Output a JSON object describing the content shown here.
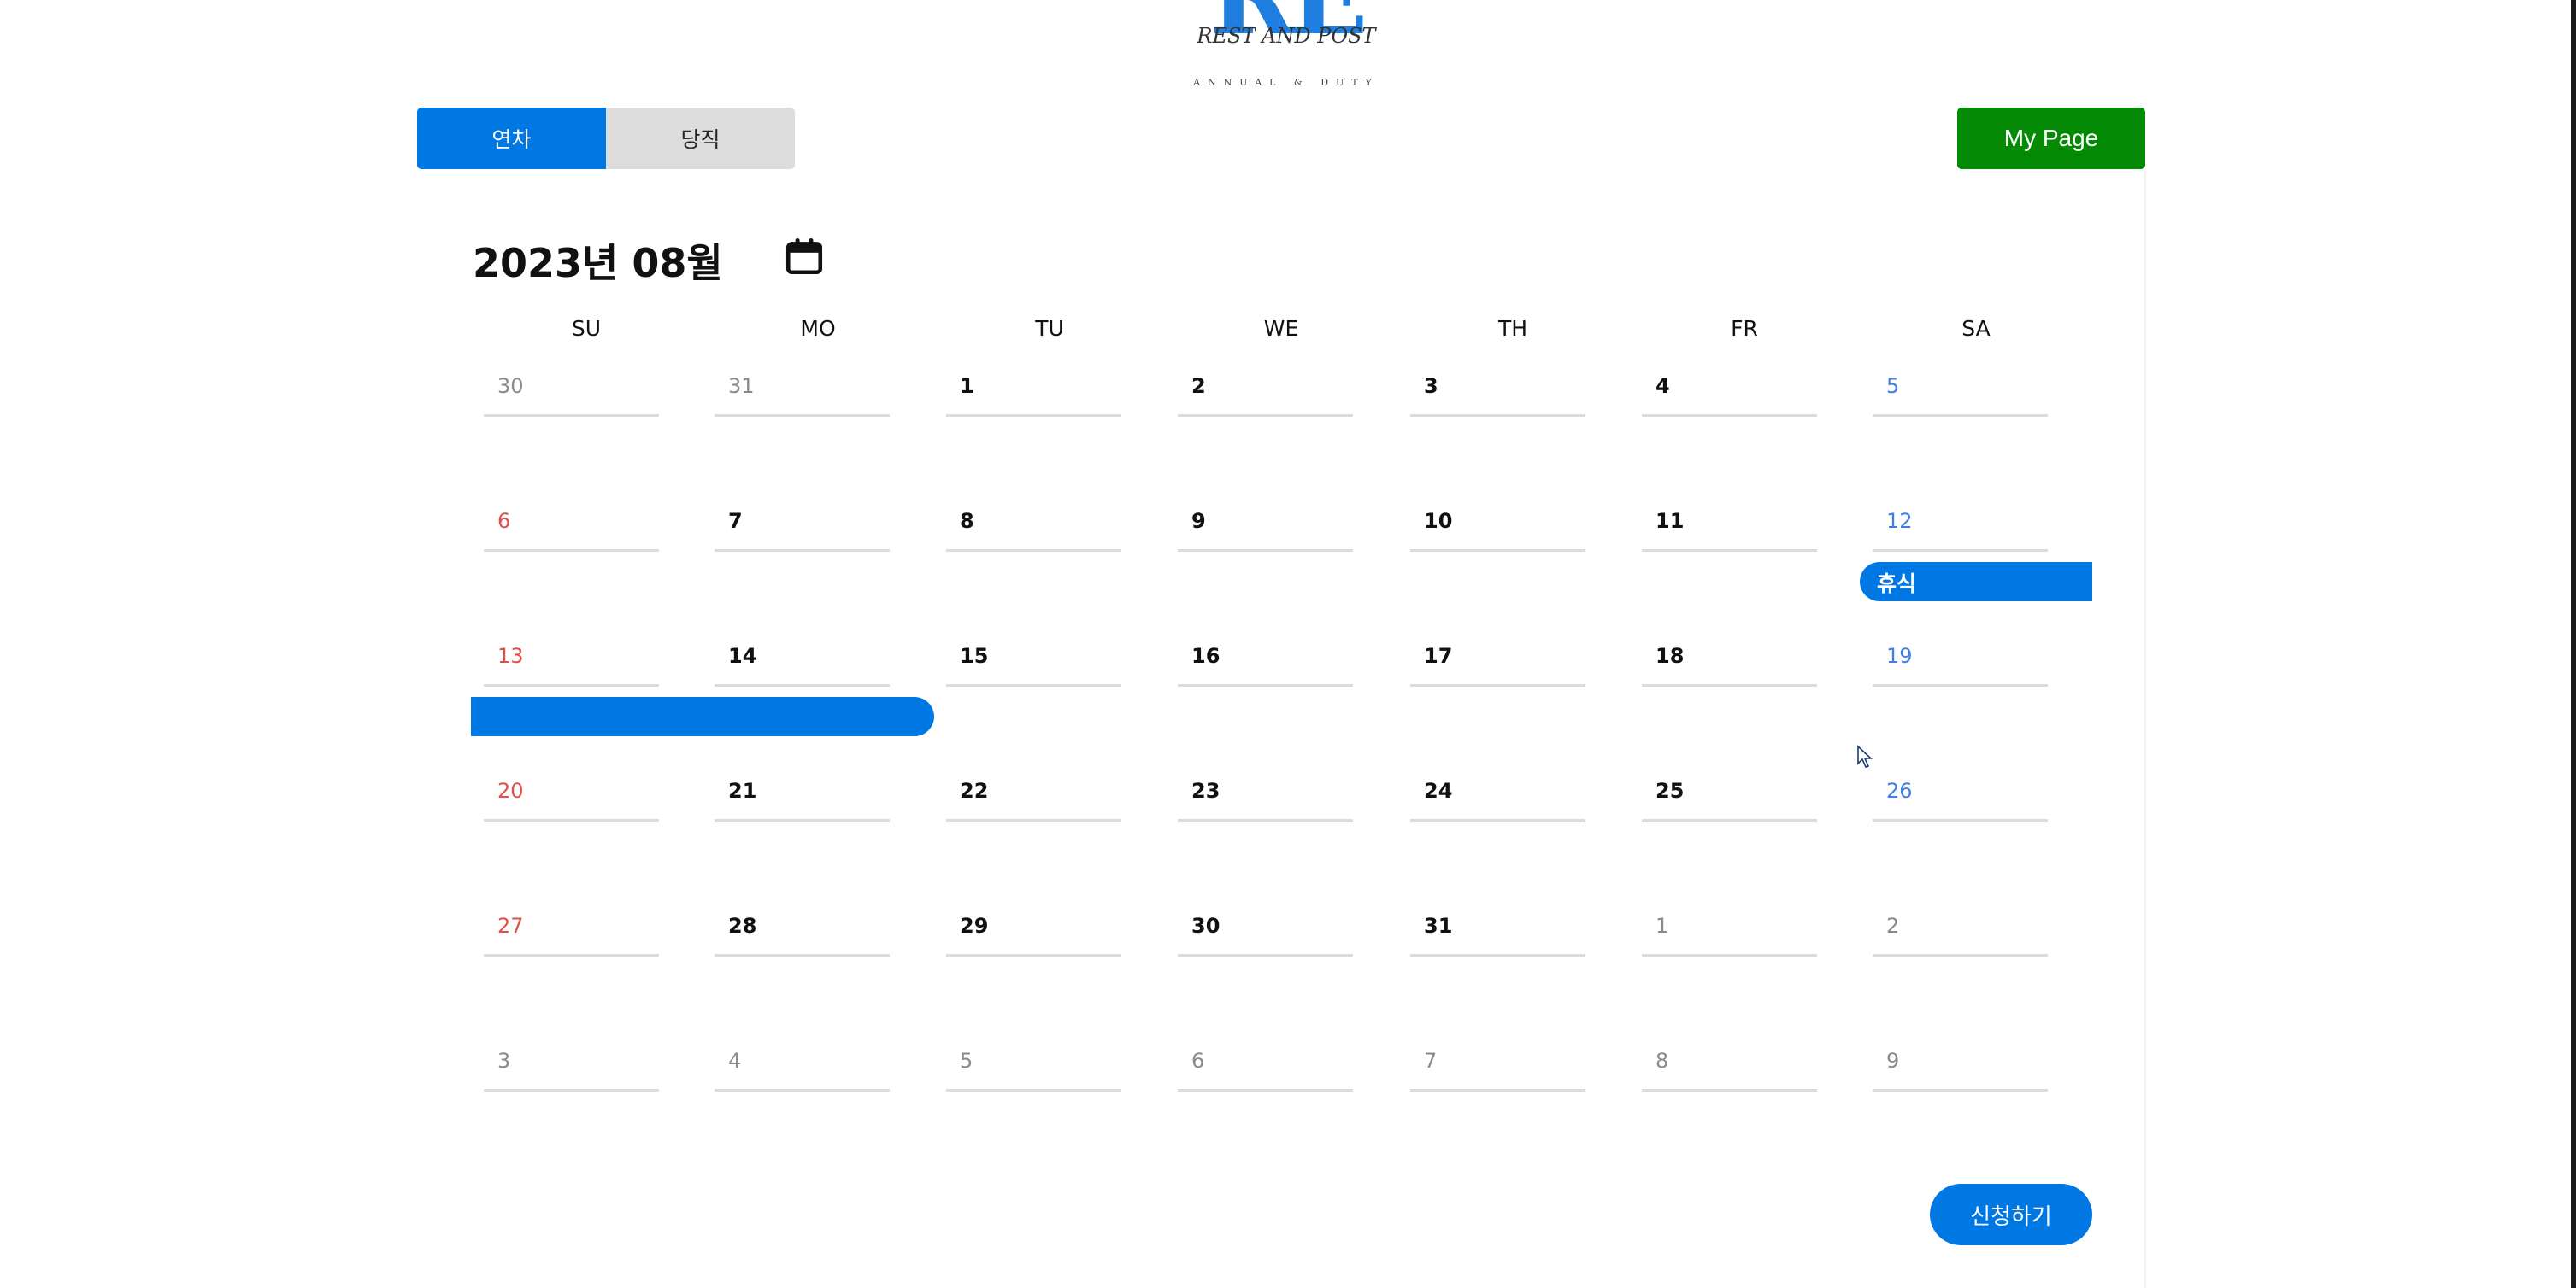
{
  "logo": {
    "mark": "RE",
    "tagline": "REST AND POST",
    "subtitle": "ANNUAL & DUTY"
  },
  "tabs": [
    {
      "label": "연차",
      "active": true
    },
    {
      "label": "당직",
      "active": false
    }
  ],
  "header": {
    "my_page_label": "My Page"
  },
  "calendar": {
    "title": "2023년 08월",
    "calendar_icon": "calendar-icon",
    "weekdays": [
      "SU",
      "MO",
      "TU",
      "WE",
      "TH",
      "FR",
      "SA"
    ],
    "weeks": [
      [
        "30",
        "31",
        "1",
        "2",
        "3",
        "4",
        "5"
      ],
      [
        "6",
        "7",
        "8",
        "9",
        "10",
        "11",
        "12"
      ],
      [
        "13",
        "14",
        "15",
        "16",
        "17",
        "18",
        "19"
      ],
      [
        "20",
        "21",
        "22",
        "23",
        "24",
        "25",
        "26"
      ],
      [
        "27",
        "28",
        "29",
        "30",
        "31",
        "1",
        "2"
      ],
      [
        "3",
        "4",
        "5",
        "6",
        "7",
        "8",
        "9"
      ]
    ],
    "events": [
      {
        "label": "휴식"
      },
      {
        "label": ""
      }
    ]
  },
  "apply_label": "신청하기",
  "colors": {
    "primary": "#0078e4",
    "mypage": "#048a04",
    "sunday": "#e0504a",
    "saturday": "#3d80e8",
    "other_month": "#8a8a8a"
  }
}
